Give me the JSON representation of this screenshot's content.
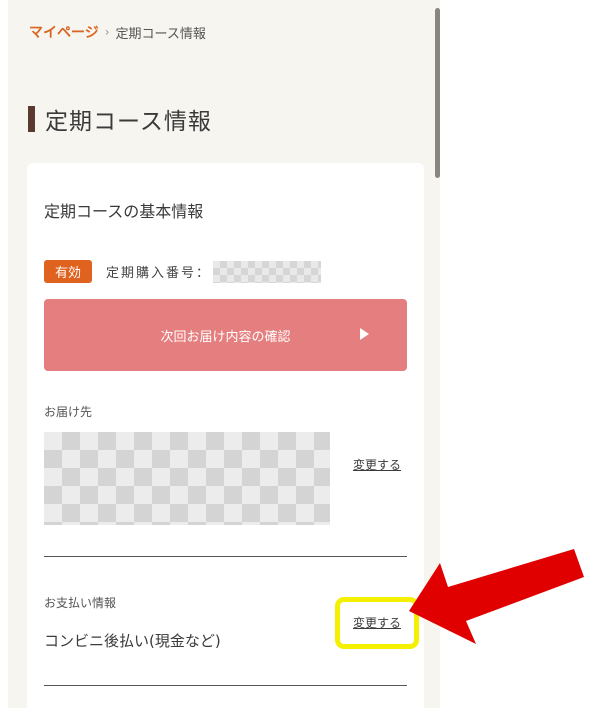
{
  "breadcrumb": {
    "home": "マイページ",
    "separator": "›",
    "current": "定期コース情報"
  },
  "page_title": "定期コース情報",
  "basic_info": {
    "section_title": "定期コースの基本情報",
    "status_badge": "有効",
    "order_number_label": "定期購入番号："
  },
  "confirm_button": {
    "label": "次回お届け内容の確認",
    "icon": "play-icon"
  },
  "delivery": {
    "label": "お届け先",
    "change_link": "変更する"
  },
  "payment": {
    "label": "お支払い情報",
    "value": "コンビニ後払い(現金など)",
    "change_link": "変更する"
  },
  "colors": {
    "accent": "#e0621f",
    "button": "#e57e7e",
    "highlight": "#f5ef00",
    "arrow": "#e00000"
  }
}
